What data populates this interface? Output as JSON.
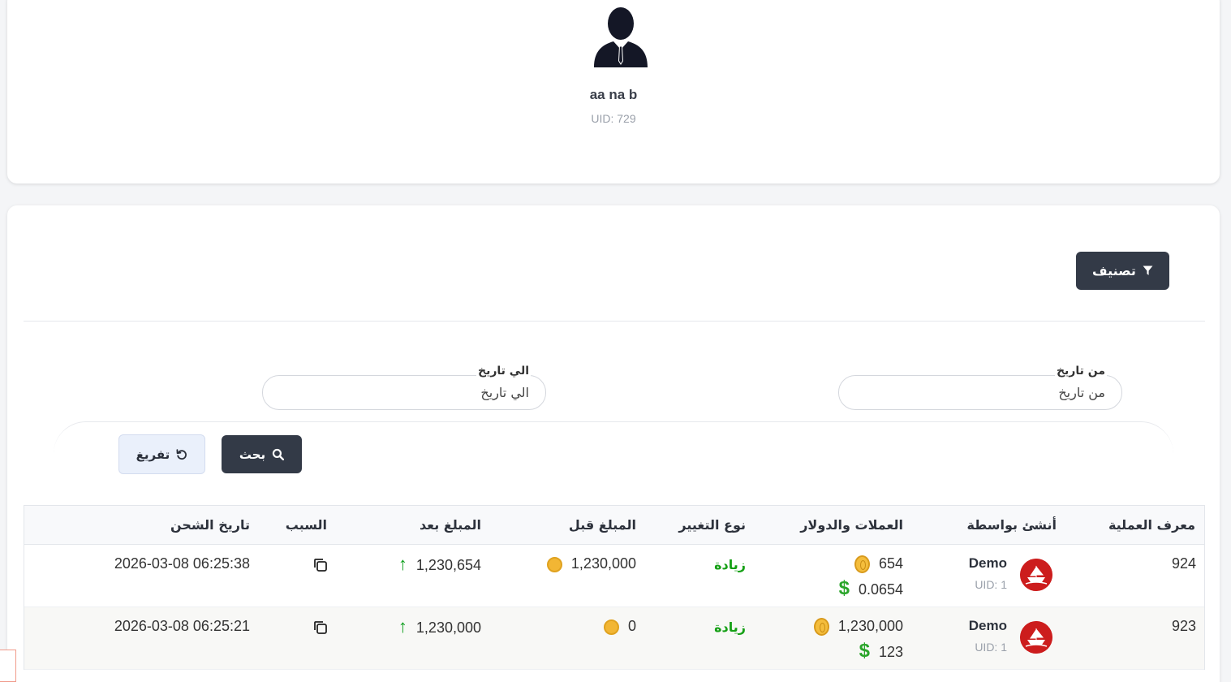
{
  "profile": {
    "name": "aa na b",
    "uid": "UID: 729"
  },
  "filter": {
    "button_label": "تصنيف"
  },
  "date_filters": {
    "from_label": "من تاريخ",
    "from_placeholder": "من تاريخ",
    "to_label": "الي تاريخ",
    "to_placeholder": "الي تاريخ"
  },
  "actions": {
    "search_label": "بحث",
    "reset_label": "تفريغ"
  },
  "table": {
    "headers": {
      "operation_id": "معرف العملية",
      "created_by": "أنشئ بواسطة",
      "coins_and_dollar": "العملات والدولار",
      "change_type": "نوع التغيير",
      "amount_before": "المبلغ قبل",
      "amount_after": "المبلغ بعد",
      "reason": "السبب",
      "charge_date": "تاريخ الشحن"
    },
    "rows": [
      {
        "operation_id": "924",
        "creator_name": "Demo",
        "creator_uid": "UID: 1",
        "coins": "654",
        "dollars": "0.0654",
        "change_type": "زيادة",
        "amount_before": "1,230,000",
        "amount_after": "1,230,654",
        "charge_date": "2026-03-08 06:25:38"
      },
      {
        "operation_id": "923",
        "creator_name": "Demo",
        "creator_uid": "UID: 1",
        "coins": "1,230,000",
        "dollars": "123",
        "change_type": "زيادة",
        "amount_before": "0",
        "amount_after": "1,230,000",
        "charge_date": "2026-03-08 06:25:21"
      }
    ]
  },
  "colors": {
    "primary_button": "#333a47",
    "increase_green": "#16a016",
    "arrow_green": "#0b9d1a",
    "coin_gold": "#f2b634",
    "dollar_green": "#2aa52a",
    "creator_logo_red": "#cc1d1d"
  },
  "icons": {
    "avatar": "user-silhouette-icon",
    "filter": "funnel-icon",
    "search": "search-icon",
    "reset": "reset-icon",
    "coin": "coin-icon",
    "dollar": "dollar-icon",
    "arrow_up": "arrow-up-icon",
    "copy": "copy-icon"
  }
}
